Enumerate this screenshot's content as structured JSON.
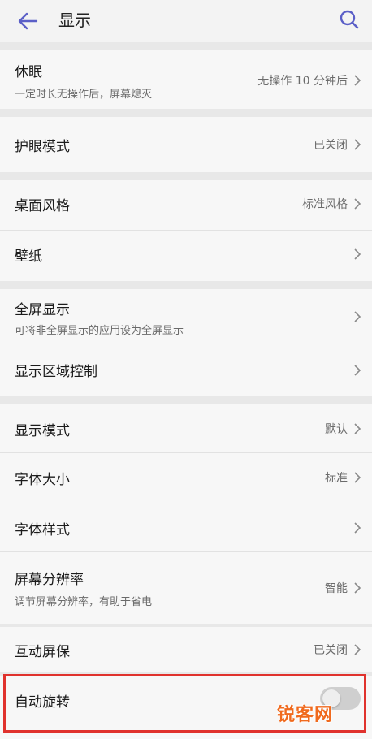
{
  "header": {
    "title": "显示",
    "back_icon": "arrow-left-icon",
    "search_icon": "search-icon",
    "accent_color": "#5b5fc7"
  },
  "settings": {
    "sleep": {
      "title": "休眠",
      "subtitle": "一定时长无操作后，屏幕熄灭",
      "value": "无操作 10 分钟后"
    },
    "eye_comfort": {
      "title": "护眼模式",
      "value": "已关闭"
    },
    "home_style": {
      "title": "桌面风格",
      "value": "标准风格"
    },
    "wallpaper": {
      "title": "壁纸"
    },
    "full_screen": {
      "title": "全屏显示",
      "subtitle": "可将非全屏显示的应用设为全屏显示"
    },
    "display_area": {
      "title": "显示区域控制"
    },
    "display_mode": {
      "title": "显示模式",
      "value": "默认"
    },
    "font_size": {
      "title": "字体大小",
      "value": "标准"
    },
    "font_style": {
      "title": "字体样式"
    },
    "resolution": {
      "title": "屏幕分辨率",
      "subtitle": "调节屏幕分辨率，有助于省电",
      "value": "智能"
    },
    "screensaver": {
      "title": "互动屏保",
      "value": "已关闭"
    },
    "auto_rotate": {
      "title": "自动旋转",
      "enabled": false
    }
  },
  "overlay": {
    "highlight_color": "#e0322d",
    "watermark": "锐客网"
  }
}
